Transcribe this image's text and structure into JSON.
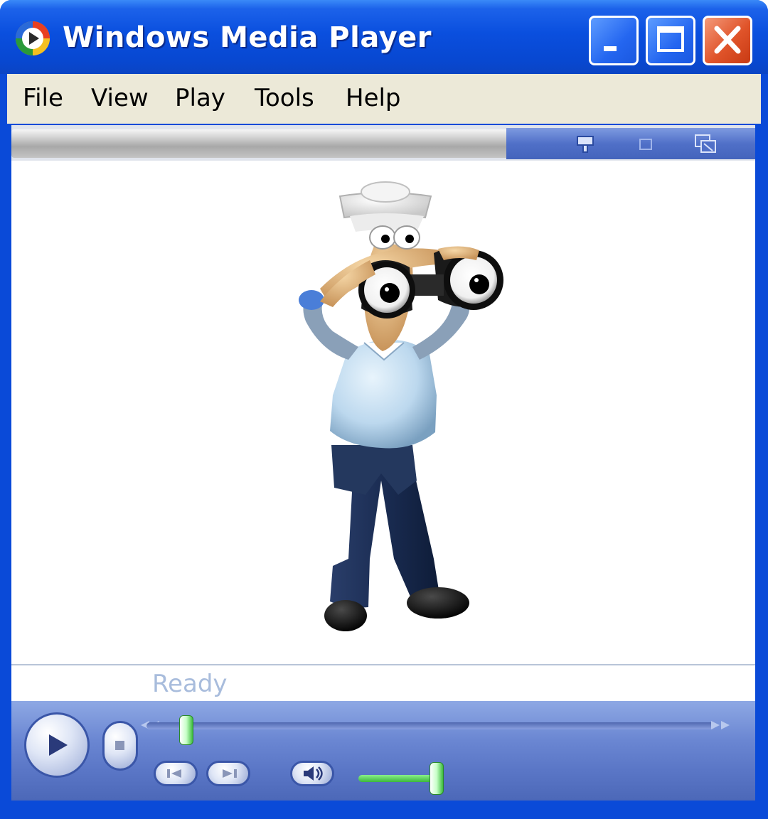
{
  "window": {
    "title": "Windows Media Player",
    "app_icon": "windows-media-player-icon",
    "buttons": {
      "minimize_icon": "minimize-icon",
      "maximize_icon": "maximize-icon",
      "close_icon": "close-icon"
    }
  },
  "menu": {
    "items": [
      {
        "label": "File"
      },
      {
        "label": "View"
      },
      {
        "label": "Play"
      },
      {
        "label": "Tools"
      },
      {
        "label": "Help"
      }
    ]
  },
  "view_controls": {
    "icons": [
      "compact-mode-icon",
      "full-mode-icon",
      "switch-skin-icon"
    ]
  },
  "video": {
    "content": "animated sailor character holding binoculars"
  },
  "status": {
    "text": "Ready"
  },
  "transport": {
    "play_icon": "play-icon",
    "stop_icon": "stop-icon",
    "previous_icon": "previous-track-icon",
    "next_icon": "next-track-icon",
    "mute_icon": "mute-icon",
    "rewind_icon": "rewind-icon",
    "fast_forward_icon": "fast-forward-icon",
    "seek_position": 0.0,
    "volume_level": 1.0
  },
  "colors": {
    "title_bar": "#0a4fde",
    "menu_bar": "#ece9d8",
    "close_button": "#e0542a",
    "controls": "#6a86d2",
    "slider_green": "#3cbc3c",
    "status_text": "#a8bcdc"
  }
}
